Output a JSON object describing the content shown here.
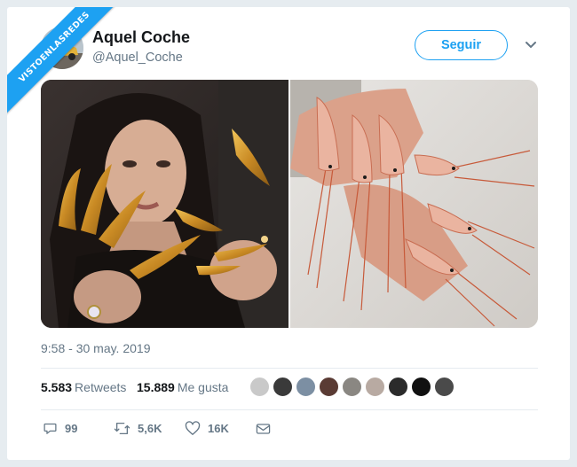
{
  "watermark": {
    "text": "VISTOENLASREDES"
  },
  "tweet": {
    "display_name": "Aquel Coche",
    "handle": "@Aquel_Coche",
    "follow_label": "Seguir",
    "timestamp": "9:58 - 30 may. 2019",
    "stats": {
      "retweets_count": "5.583",
      "retweets_label": "Retweets",
      "likes_count": "15.889",
      "likes_label": "Me gusta"
    },
    "actions": {
      "replies": "99",
      "retweets": "5,6K",
      "likes": "16K"
    }
  },
  "colors": {
    "accent": "#1da1f2",
    "secondary_text": "#657786",
    "border": "#e6ecf0",
    "background": "#e6ecf0"
  },
  "icons": [
    "reply-icon",
    "retweet-icon",
    "like-icon",
    "dm-icon",
    "chevron-down-icon"
  ]
}
